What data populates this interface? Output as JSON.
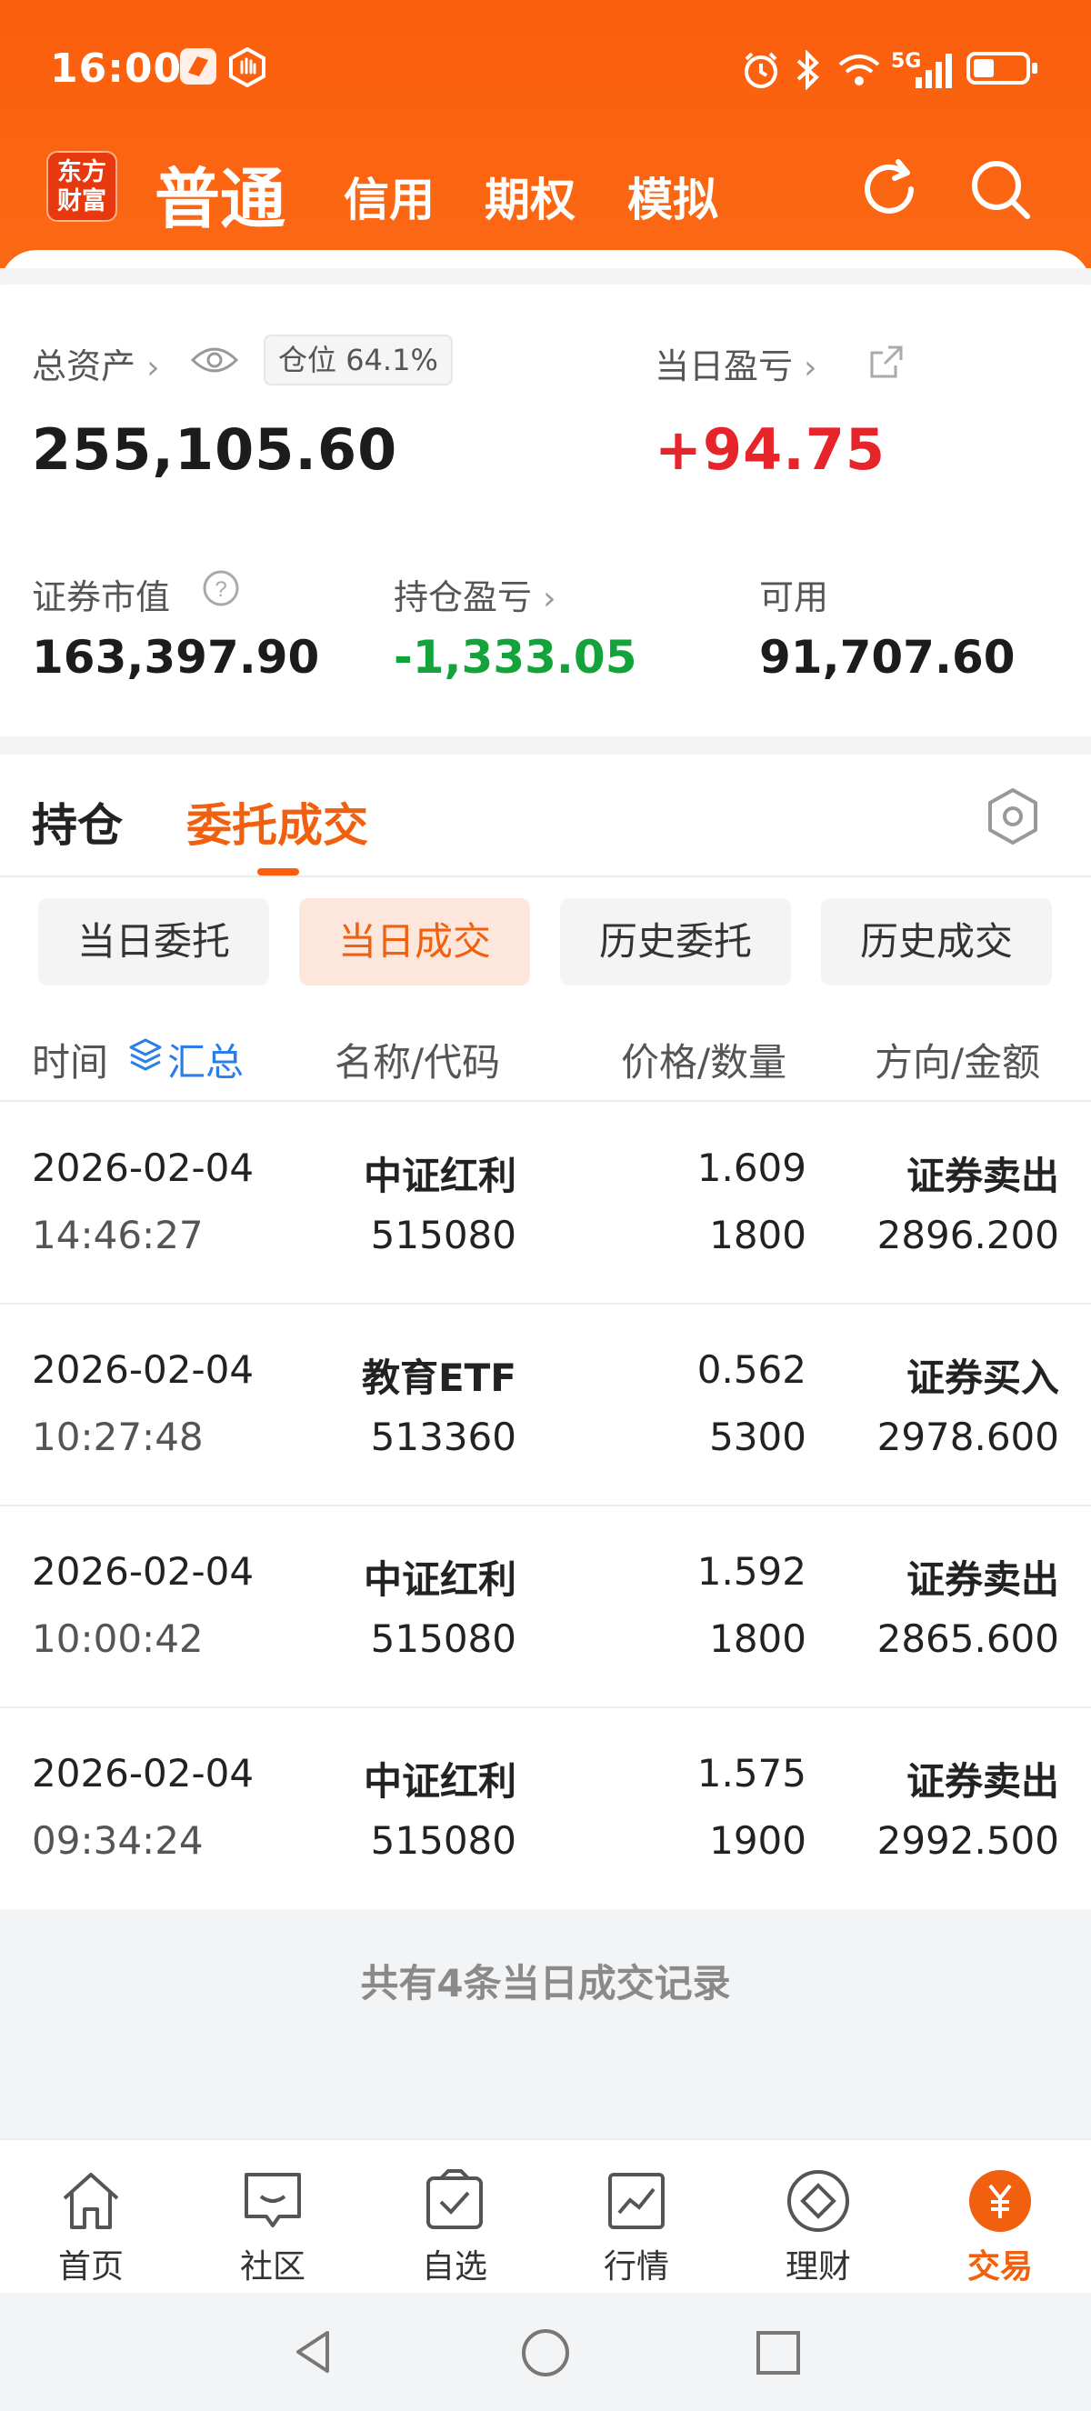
{
  "status_bar": {
    "time": "16:00",
    "network": "5G"
  },
  "app": {
    "logo_line1": "东方",
    "logo_line2": "财富",
    "account_tabs": [
      "普通",
      "信用",
      "期权",
      "模拟"
    ]
  },
  "summary": {
    "total_assets_label": "总资产",
    "total_assets": "255,105.60",
    "position_ratio_label": "仓位",
    "position_ratio": "64.1%",
    "daily_pl_label": "当日盈亏",
    "daily_pl": "+94.75",
    "market_value_label": "证券市值",
    "market_value": "163,397.90",
    "holding_pl_label": "持仓盈亏",
    "holding_pl": "-1,333.05",
    "available_label": "可用",
    "available": "91,707.60"
  },
  "panel_tabs": {
    "holdings": "持仓",
    "orders": "委托成交"
  },
  "segments": [
    "当日委托",
    "当日成交",
    "历史委托",
    "历史成交"
  ],
  "table_header": {
    "time": "时间",
    "aggregate": "汇总",
    "name": "名称/代码",
    "price": "价格/数量",
    "direction": "方向/金额"
  },
  "trades": [
    {
      "date": "2026-02-04",
      "time": "14:46:27",
      "name": "中证红利",
      "code": "515080",
      "price": "1.609",
      "qty": "1800",
      "direction": "证券卖出",
      "amount": "2896.200"
    },
    {
      "date": "2026-02-04",
      "time": "10:27:48",
      "name": "教育ETF",
      "code": "513360",
      "price": "0.562",
      "qty": "5300",
      "direction": "证券买入",
      "amount": "2978.600"
    },
    {
      "date": "2026-02-04",
      "time": "10:00:42",
      "name": "中证红利",
      "code": "515080",
      "price": "1.592",
      "qty": "1800",
      "direction": "证券卖出",
      "amount": "2865.600"
    },
    {
      "date": "2026-02-04",
      "time": "09:34:24",
      "name": "中证红利",
      "code": "515080",
      "price": "1.575",
      "qty": "1900",
      "direction": "证券卖出",
      "amount": "2992.500"
    }
  ],
  "trades_summary": "共有4条当日成交记录",
  "bottom_nav": [
    "首页",
    "社区",
    "自选",
    "行情",
    "理财",
    "交易"
  ],
  "colors": {
    "brand": "#fb5e0c",
    "up": "#e62429",
    "down": "#13a33a",
    "link": "#2a7ee8"
  }
}
